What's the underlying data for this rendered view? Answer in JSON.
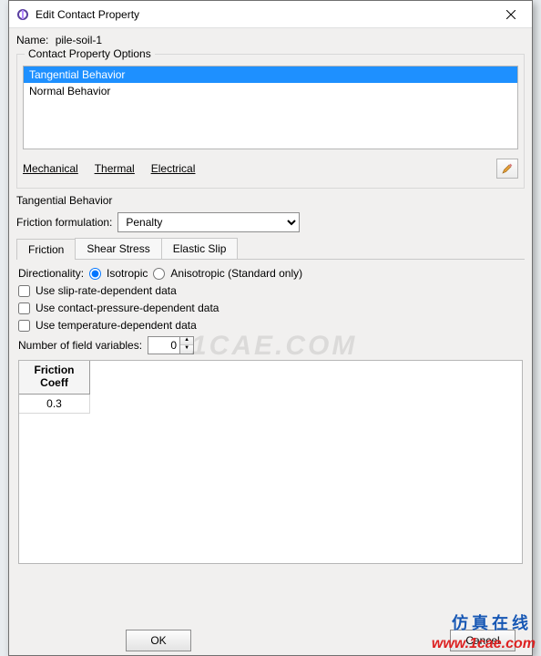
{
  "window": {
    "title": "Edit Contact Property"
  },
  "name_label": "Name:",
  "name_value": "pile-soil-1",
  "options_group_label": "Contact Property Options",
  "options": [
    {
      "label": "Tangential Behavior",
      "selected": true
    },
    {
      "label": "Normal Behavior",
      "selected": false
    }
  ],
  "menus": {
    "mechanical": "Mechanical",
    "thermal": "Thermal",
    "electrical": "Electrical"
  },
  "panel": {
    "title": "Tangential Behavior",
    "friction_formulation_label": "Friction formulation:",
    "friction_formulation_value": "Penalty",
    "tabs": {
      "friction": "Friction",
      "shear_stress": "Shear Stress",
      "elastic_slip": "Elastic Slip"
    },
    "directionality_label": "Directionality:",
    "isotropic_label": "Isotropic",
    "anisotropic_label": "Anisotropic (Standard only)",
    "directionality_value": "isotropic",
    "slip_rate_label": "Use slip-rate-dependent data",
    "slip_rate_checked": false,
    "contact_pressure_label": "Use contact-pressure-dependent data",
    "contact_pressure_checked": false,
    "temperature_label": "Use temperature-dependent data",
    "temperature_checked": false,
    "field_vars_label": "Number of field variables:",
    "field_vars_value": "0",
    "coeff_header_line1": "Friction",
    "coeff_header_line2": "Coeff",
    "coeff_value": "0.3"
  },
  "buttons": {
    "ok": "OK",
    "cancel": "Cancel"
  },
  "watermark": "1CAE.COM",
  "brand_zh": "仿真在线",
  "brand_url": "www.1cae.com"
}
